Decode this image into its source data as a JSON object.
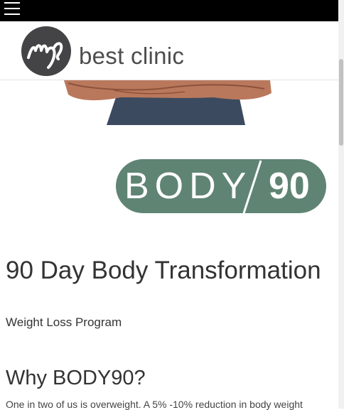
{
  "nav": {
    "menu_icon": "hamburger-menu-icon"
  },
  "brand": {
    "logo_mark": "my",
    "name": "best clinic"
  },
  "program_badge": {
    "word": "BODY",
    "number": "90"
  },
  "content": {
    "title": "90 Day Body Transformation",
    "subtitle": "Weight Loss Program",
    "section_heading": "Why BODY90?",
    "paragraph": "One in two of us is overweight. A 5% -10% reduction in body weight"
  },
  "colors": {
    "topbar": "#000000",
    "badge_green": "#5f8474",
    "logo_circle": "#444446",
    "text": "#333333"
  }
}
